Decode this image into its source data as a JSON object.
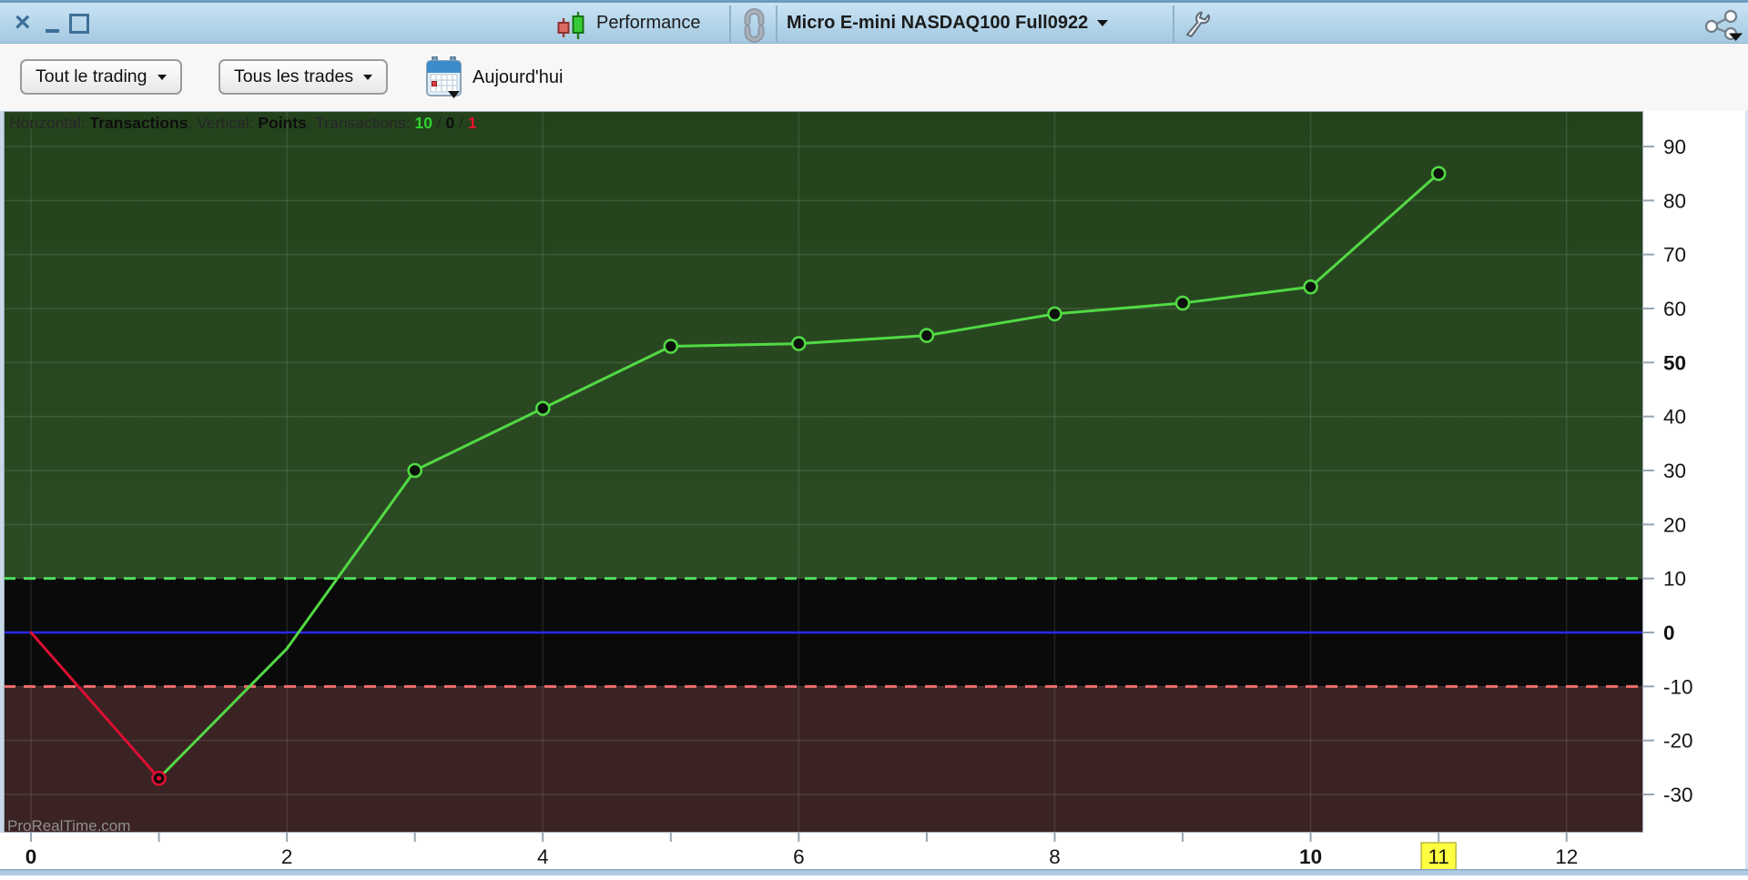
{
  "window": {
    "controls": {
      "close": "×",
      "minimize": "minimize",
      "maximize": "maximize"
    }
  },
  "titlebar": {
    "performance_label": "Performance",
    "instrument": "Micro E-mini NASDAQ100 Full0922",
    "icons": [
      "candlestick-performance-icon",
      "link-icon",
      "wrench-icon",
      "share-icon"
    ]
  },
  "toolbar": {
    "trading_filter": "Tout le trading",
    "trades_filter": "Tous les trades",
    "date_label": "Aujourd'hui",
    "icons": [
      "calendar-icon"
    ]
  },
  "watermark": "ProRealTime.com",
  "info_bar": {
    "segments": [
      {
        "text": "Horizontal: ",
        "style": "normal"
      },
      {
        "text": "Transactions",
        "style": "bold"
      },
      {
        "text": ", Vertical: ",
        "style": "normal"
      },
      {
        "text": "Points",
        "style": "bold"
      },
      {
        "text": ", Transactions: ",
        "style": "normal"
      },
      {
        "text": "10",
        "style": "green"
      },
      {
        "text": " / ",
        "style": "normal"
      },
      {
        "text": "0",
        "style": "bold"
      },
      {
        "text": " / ",
        "style": "normal"
      },
      {
        "text": "1",
        "style": "red"
      }
    ]
  },
  "chart_data": {
    "type": "line",
    "x_axis": "Transactions",
    "y_axis": "Points",
    "transactions_summary": {
      "wins": "10",
      "flat": "0",
      "losses": "1"
    },
    "points": [
      {
        "x": 0,
        "y": 0,
        "marker": "none"
      },
      {
        "x": 1,
        "y": -27,
        "marker": "red"
      },
      {
        "x": 2,
        "y": -3,
        "marker": "none"
      },
      {
        "x": 3,
        "y": 30,
        "marker": "green"
      },
      {
        "x": 4,
        "y": 41.5,
        "marker": "green"
      },
      {
        "x": 5,
        "y": 53,
        "marker": "green"
      },
      {
        "x": 6,
        "y": 53.5,
        "marker": "green"
      },
      {
        "x": 7,
        "y": 55,
        "marker": "green"
      },
      {
        "x": 8,
        "y": 59,
        "marker": "green"
      },
      {
        "x": 9,
        "y": 61,
        "marker": "green"
      },
      {
        "x": 10,
        "y": 64,
        "marker": "green"
      },
      {
        "x": 11,
        "y": 85,
        "marker": "green"
      }
    ],
    "ylim": [
      -37,
      96.5
    ],
    "xlim": [
      -0.21,
      12.6
    ],
    "grid": true,
    "y_ticks": [
      {
        "v": 90,
        "label": "90"
      },
      {
        "v": 80,
        "label": "80"
      },
      {
        "v": 70,
        "label": "70"
      },
      {
        "v": 60,
        "label": "60"
      },
      {
        "v": 50,
        "label": "50",
        "bold": true
      },
      {
        "v": 40,
        "label": "40"
      },
      {
        "v": 30,
        "label": "30"
      },
      {
        "v": 20,
        "label": "20"
      },
      {
        "v": 10,
        "label": "10"
      },
      {
        "v": 0,
        "label": "0",
        "bold": true
      },
      {
        "v": -10,
        "label": "-10"
      },
      {
        "v": -20,
        "label": "-20"
      },
      {
        "v": -30,
        "label": "-30"
      }
    ],
    "x_labels": [
      {
        "v": 0,
        "label": "0",
        "bold": true
      },
      {
        "v": 2,
        "label": "2"
      },
      {
        "v": 4,
        "label": "4"
      },
      {
        "v": 6,
        "label": "6"
      },
      {
        "v": 8,
        "label": "8"
      },
      {
        "v": 10,
        "label": "10",
        "bold": true
      },
      {
        "v": 11,
        "label": "11",
        "highlight": true
      },
      {
        "v": 12,
        "label": "12"
      }
    ],
    "x_minor_ticks": [
      0,
      1,
      2,
      3,
      4,
      5,
      6,
      7,
      8,
      9,
      10,
      11,
      12
    ],
    "h_gridlines": [
      90,
      80,
      70,
      60,
      50,
      40,
      30,
      20,
      -20,
      -30
    ],
    "v_gridlines": [
      0,
      2,
      4,
      6,
      8,
      10,
      12
    ],
    "ref_lines": {
      "zero": 0,
      "upper_dashed": 10,
      "lower_dashed": -10
    },
    "zones": {
      "green_above": 10,
      "black_between": [
        -10,
        10
      ],
      "red_below": -10
    },
    "colors": {
      "zone_green": "#2c4b25",
      "zone_green_top": "#24431d",
      "zone_black": "#0a0a0a",
      "zone_red": "#3b2323",
      "line_green": "#52d944",
      "line_red": "#dc0f32",
      "marker_fill": "#0c110c",
      "zero_line": "#2a28ea",
      "dashed_green": "#50dc5c",
      "dashed_red": "#ef6e6e",
      "grid_line": "rgba(255,255,255,0.10)",
      "axis_text": "#141414",
      "tick": "#97a5b2",
      "highlight_bg": "#ffff42",
      "watermark": "#8f8f8f"
    }
  }
}
